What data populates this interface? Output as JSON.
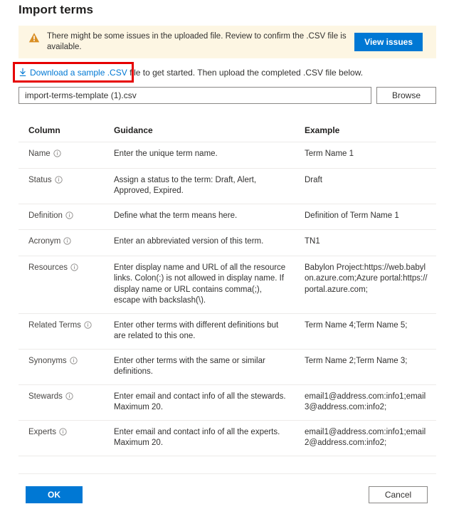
{
  "dialog": {
    "title": "Import terms"
  },
  "banner": {
    "icon": "warning-triangle-icon",
    "message": "There might be some issues in the uploaded file. Review to confirm the .CSV file is available.",
    "action_label": "View issues",
    "background_color": "#fdf6e3",
    "icon_color": "#d98f24",
    "button_color": "#0078d4"
  },
  "instruction": {
    "link_icon": "download-icon",
    "link_text": "Download a sample .CSV",
    "rest_text": " file to get started. Then upload the completed .CSV file below.",
    "link_color": "#0078d4",
    "highlight_color": "#e60000"
  },
  "file_picker": {
    "value": "import-terms-template (1).csv",
    "placeholder": "",
    "browse_label": "Browse"
  },
  "table": {
    "headers": {
      "column": "Column",
      "guidance": "Guidance",
      "example": "Example"
    },
    "rows": [
      {
        "column": "Name",
        "info_icon": "info-circle-icon",
        "guidance": "Enter the unique term name.",
        "example": "Term Name 1"
      },
      {
        "column": "Status",
        "info_icon": "info-circle-icon",
        "guidance": "Assign a status to the term: Draft, Alert, Approved, Expired.",
        "example": "Draft"
      },
      {
        "column": "Definition",
        "info_icon": "info-circle-icon",
        "guidance": "Define what the term means here.",
        "example": "Definition of Term Name 1"
      },
      {
        "column": "Acronym",
        "info_icon": "info-circle-icon",
        "guidance": "Enter an abbreviated version of this term.",
        "example": "TN1"
      },
      {
        "column": "Resources",
        "info_icon": "info-circle-icon",
        "guidance": "Enter display name and URL of all the resource links. Colon(:) is not allowed in display name. If display name or URL contains comma(;), escape with backslash(\\).",
        "example": "Babylon Project:https://web.babylon.azure.com;Azure portal:https://portal.azure.com;"
      },
      {
        "column": "Related Terms",
        "info_icon": "info-circle-icon",
        "guidance": "Enter other terms with different definitions but are related to this one.",
        "example": "Term Name 4;Term Name 5;"
      },
      {
        "column": "Synonyms",
        "info_icon": "info-circle-icon",
        "guidance": "Enter other terms with the same or similar definitions.",
        "example": "Term Name 2;Term Name 3;"
      },
      {
        "column": "Stewards",
        "info_icon": "info-circle-icon",
        "guidance": "Enter email and contact info of all the stewards. Maximum 20.",
        "example": "email1@address.com:info1;email3@address.com:info2;"
      },
      {
        "column": "Experts",
        "info_icon": "info-circle-icon",
        "guidance": "Enter email and contact info of all the experts. Maximum 20.",
        "example": "email1@address.com:info1;email2@address.com:info2;"
      }
    ]
  },
  "footer": {
    "ok_label": "OK",
    "cancel_label": "Cancel"
  }
}
